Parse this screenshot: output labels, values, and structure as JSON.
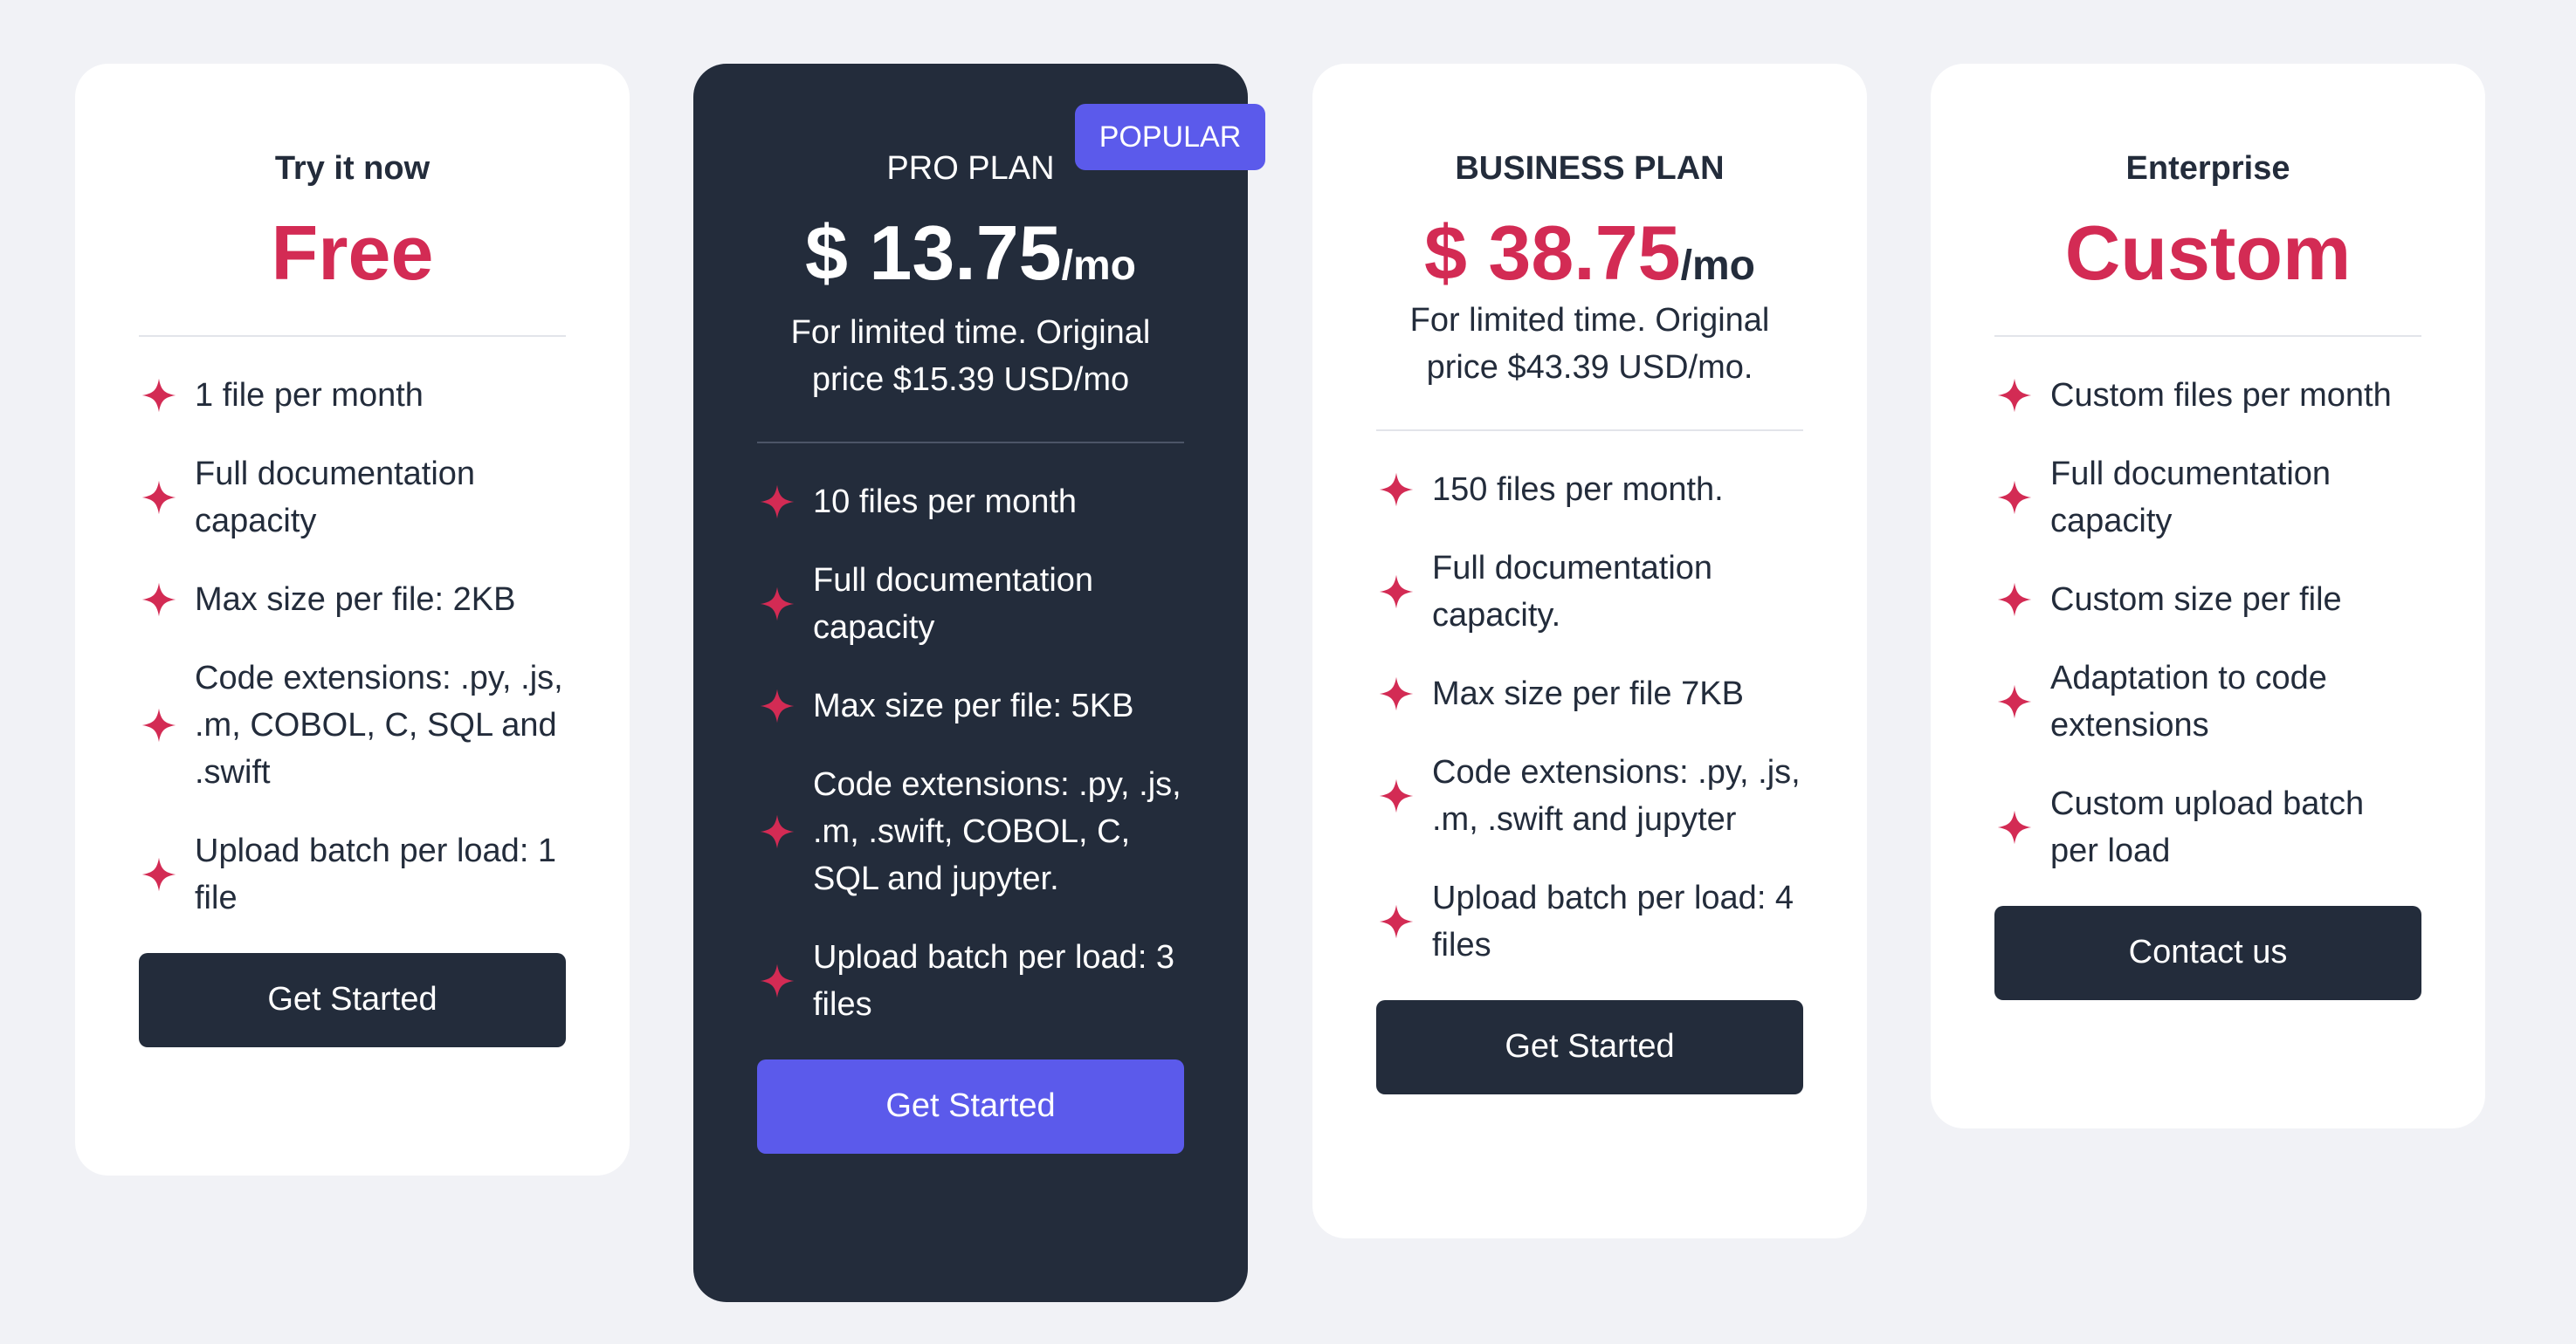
{
  "colors": {
    "page_background": "#f1f2f6",
    "card_background": "#ffffff",
    "dark_card_background": "#232c3b",
    "accent_price": "#d32b54",
    "accent_button": "#5b5aeb",
    "button_dark": "#232c3b"
  },
  "icons": {
    "feature_bullet": "sparkle-star-icon"
  },
  "plans": [
    {
      "name": "Try it now",
      "price": "Free",
      "per": "",
      "note": "",
      "features": [
        "1 file per month",
        "Full documentation capacity",
        "Max size per file: 2KB",
        "Code extensions: .py, .js, .m, COBOL, C, SQL and .swift",
        "Upload batch per load: 1 file"
      ],
      "button": "Get Started"
    },
    {
      "name": "PRO PLAN",
      "badge": "POPULAR",
      "price": "$ 13.75",
      "per": "/mo",
      "note": "For limited time. Original price $15.39 USD/mo",
      "features": [
        "10 files per month",
        "Full documentation capacity",
        "Max size per file: 5KB",
        "Code extensions: .py, .js, .m, .swift, COBOL, C, SQL and jupyter.",
        "Upload batch per load: 3 files"
      ],
      "button": "Get Started"
    },
    {
      "name": "BUSINESS PLAN",
      "price": "$ 38.75",
      "per": "/mo",
      "note": "For limited time. Original price $43.39 USD/mo.",
      "features": [
        "150 files per month.",
        "Full documentation capacity.",
        "Max size per file 7KB",
        "Code extensions: .py, .js, .m, .swift and jupyter",
        "Upload batch per load: 4 files"
      ],
      "button": "Get Started"
    },
    {
      "name": "Enterprise",
      "price": "Custom",
      "per": "",
      "note": "",
      "features": [
        "Custom files per month",
        "Full documentation capacity",
        "Custom size per file",
        "Adaptation to code extensions",
        "Custom upload batch per load"
      ],
      "button": "Contact us"
    }
  ]
}
